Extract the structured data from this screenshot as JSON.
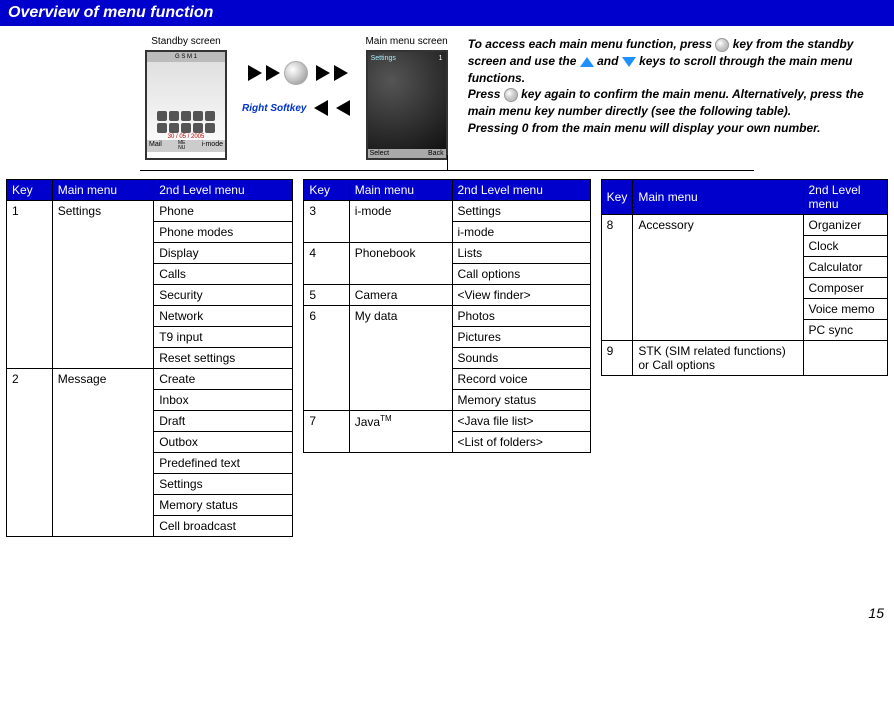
{
  "title": "Overview of menu function",
  "standby_label": "Standby screen",
  "main_label": "Main menu screen",
  "phone": {
    "carrier": "G S M  1",
    "date": "30 / 05 / 2005",
    "left_soft": "Mail",
    "right_soft": "i-mode",
    "center_soft": "ME\nNU"
  },
  "menu": {
    "title": "Settings",
    "num": "1",
    "left_soft": "Select",
    "right_soft": "Back"
  },
  "softkey_label": "Right Softkey",
  "instructions": {
    "p1a": "To access each main menu function, press ",
    "p1b": " key from the standby screen and use the ",
    "p1c": " and ",
    "p1d": " keys to scroll through the main menu functions.",
    "p2a": "Press ",
    "p2b": " key again to confirm the main menu. Alternatively, press the main menu key number directly (see the following table).",
    "p3": "Pressing 0 from the main menu will display your own number."
  },
  "headers": {
    "key": "Key",
    "main": "Main menu",
    "second": "2nd Level menu"
  },
  "t1": [
    {
      "key": "1",
      "main": "Settings",
      "items": [
        "Phone",
        "Phone modes",
        "Display",
        "Calls",
        "Security",
        "Network",
        "T9 input",
        "Reset settings"
      ]
    },
    {
      "key": "2",
      "main": "Message",
      "items": [
        "Create",
        "Inbox",
        "Draft",
        "Outbox",
        "Predefined text",
        "Settings",
        "Memory status",
        "Cell broadcast"
      ]
    }
  ],
  "t2": [
    {
      "key": "3",
      "main": "i-mode",
      "items": [
        "Settings",
        "i-mode"
      ]
    },
    {
      "key": "4",
      "main": "Phonebook",
      "items": [
        "Lists",
        "Call options"
      ]
    },
    {
      "key": "5",
      "main": "Camera",
      "items": [
        "<View finder>"
      ]
    },
    {
      "key": "6",
      "main": "My data",
      "items": [
        "Photos",
        "Pictures",
        "Sounds",
        "Record voice",
        "Memory status"
      ]
    },
    {
      "key": "7",
      "main_html": "Java<sup>TM</sup>",
      "items": [
        "<Java file list>",
        "<List of folders>"
      ]
    }
  ],
  "t3": [
    {
      "key": "8",
      "main": "Accessory",
      "items": [
        "Organizer",
        "Clock",
        "Calculator",
        "Composer",
        "Voice memo",
        "PC sync"
      ]
    },
    {
      "key": "9",
      "main": "STK (SIM related functions) or Call  options",
      "items": [
        ""
      ]
    }
  ],
  "page_num": "15"
}
